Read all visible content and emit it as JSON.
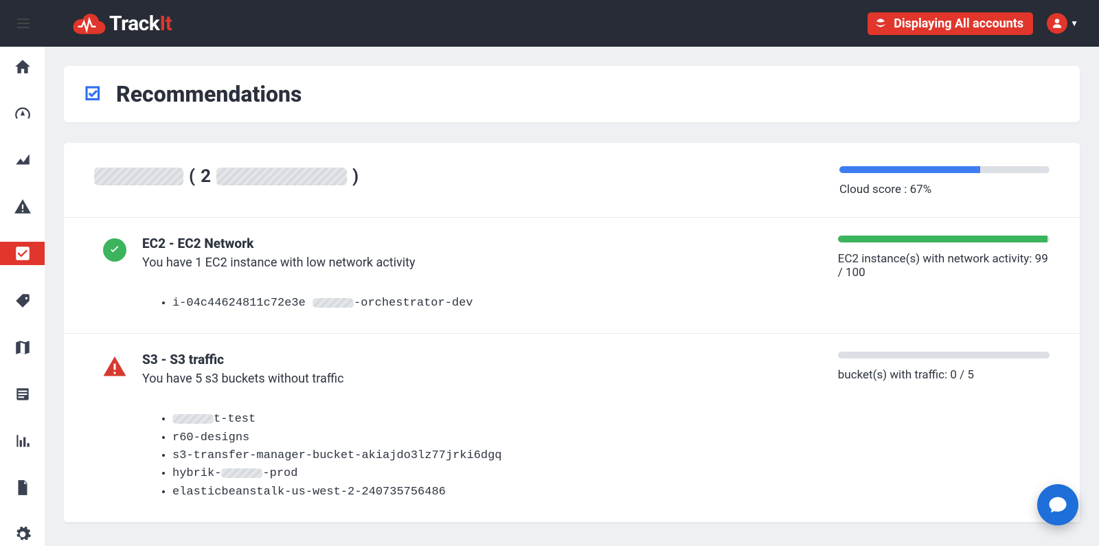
{
  "brand": {
    "name_a": "Track",
    "name_b": "It"
  },
  "topbar": {
    "account_badge": "Displaying All accounts"
  },
  "sidebar": {
    "items": [
      {
        "name": "home"
      },
      {
        "name": "dashboard"
      },
      {
        "name": "analytics"
      },
      {
        "name": "alerts"
      },
      {
        "name": "recommendations",
        "active": true
      },
      {
        "name": "tags"
      },
      {
        "name": "map"
      },
      {
        "name": "billing"
      },
      {
        "name": "reports"
      },
      {
        "name": "documents"
      },
      {
        "name": "settings"
      }
    ]
  },
  "page": {
    "title": "Recommendations"
  },
  "account": {
    "name_redacted": true,
    "paren_open": "(",
    "paren_prefix": "2",
    "paren_close": ")",
    "cloud_score_label": "Cloud score : 67%",
    "cloud_score_pct": 67
  },
  "recs": [
    {
      "status": "ok",
      "title": "EC2 - EC2 Network",
      "subtitle": "You have 1 EC2 instance with low network activity",
      "metric_label": "EC2 instance(s) with network activity: 99 / 100",
      "metric_pct": 99,
      "items": [
        {
          "pre": "i-04c44624811c72e3e ",
          "redacted": true,
          "post": "-orchestrator-dev"
        }
      ]
    },
    {
      "status": "warn",
      "title": "S3 - S3 traffic",
      "subtitle": "You have 5 s3 buckets without traffic",
      "metric_label": "bucket(s) with traffic: 0 / 5",
      "metric_pct": 0,
      "items": [
        {
          "pre": "",
          "redacted": true,
          "post": "t-test"
        },
        {
          "pre": "r60-designs",
          "redacted": false,
          "post": ""
        },
        {
          "pre": "s3-transfer-manager-bucket-akiajdo3lz77jrki6dgq",
          "redacted": false,
          "post": ""
        },
        {
          "pre": "hybrik-",
          "redacted": true,
          "post": "-prod"
        },
        {
          "pre": "elasticbeanstalk-us-west-2-240735756486",
          "redacted": false,
          "post": ""
        }
      ]
    }
  ],
  "colors": {
    "accent": "#e0362b",
    "ok": "#3cb35d",
    "warn": "#d63a2f",
    "progress_blue": "#3e7cf0",
    "chat": "#1e6fd9"
  }
}
